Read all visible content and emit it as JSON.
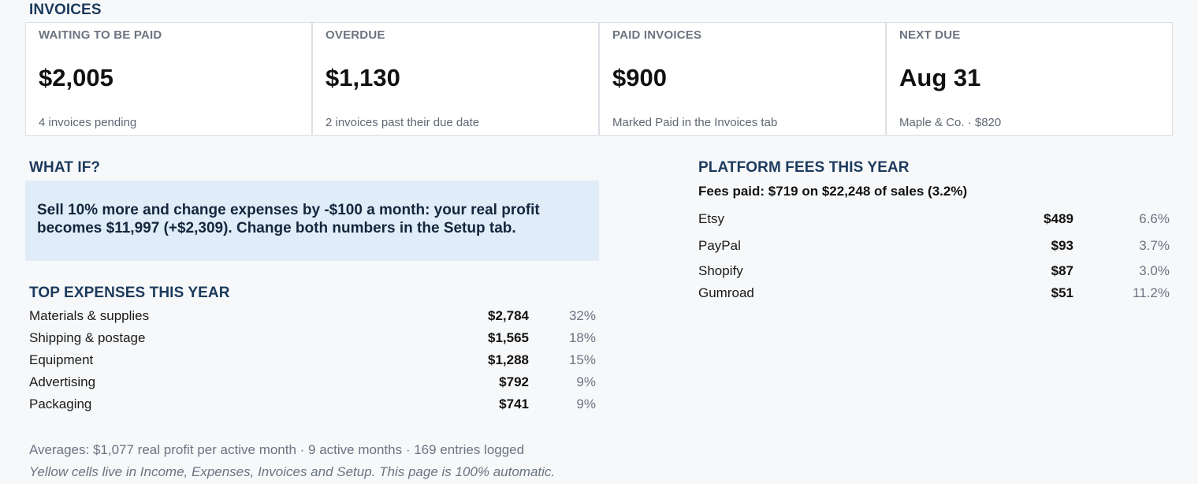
{
  "invoices": {
    "title": "INVOICES",
    "cards": [
      {
        "label": "WAITING TO BE PAID",
        "value": "$2,005",
        "sub": "4 invoices pending"
      },
      {
        "label": "OVERDUE",
        "value": "$1,130",
        "sub": "2 invoices past their due date"
      },
      {
        "label": "PAID INVOICES",
        "value": "$900",
        "sub": "Marked Paid in the Invoices tab"
      },
      {
        "label": "NEXT DUE",
        "value": "Aug 31",
        "sub": "Maple & Co. · $820"
      }
    ]
  },
  "whatif": {
    "title": "WHAT IF?",
    "text": "Sell 10% more and change expenses by -$100 a month: your real profit becomes $11,997 (+$2,309). Change both numbers in the Setup tab."
  },
  "expenses": {
    "title": "TOP EXPENSES THIS YEAR",
    "rows": [
      {
        "name": "Materials & supplies",
        "amount": "$2,784",
        "pct": "32%"
      },
      {
        "name": "Shipping & postage",
        "amount": "$1,565",
        "pct": "18%"
      },
      {
        "name": "Equipment",
        "amount": "$1,288",
        "pct": "15%"
      },
      {
        "name": "Advertising",
        "amount": "$792",
        "pct": "9%"
      },
      {
        "name": "Packaging",
        "amount": "$741",
        "pct": "9%"
      }
    ]
  },
  "fees": {
    "title": "PLATFORM FEES THIS YEAR",
    "summary": "Fees paid: $719 on $22,248 of sales (3.2%)",
    "rows": [
      {
        "name": "Etsy",
        "amount": "$489",
        "pct": "6.6%"
      },
      {
        "name": "PayPal",
        "amount": "$93",
        "pct": "3.7%"
      },
      {
        "name": "Shopify",
        "amount": "$87",
        "pct": "3.0%"
      },
      {
        "name": "Gumroad",
        "amount": "$51",
        "pct": "11.2%"
      }
    ]
  },
  "footer": {
    "averages": "Averages: $1,077 real profit per active month · 9 active months · 169 entries logged",
    "note": "Yellow cells live in Income, Expenses, Invoices and Setup. This page is 100% automatic."
  }
}
